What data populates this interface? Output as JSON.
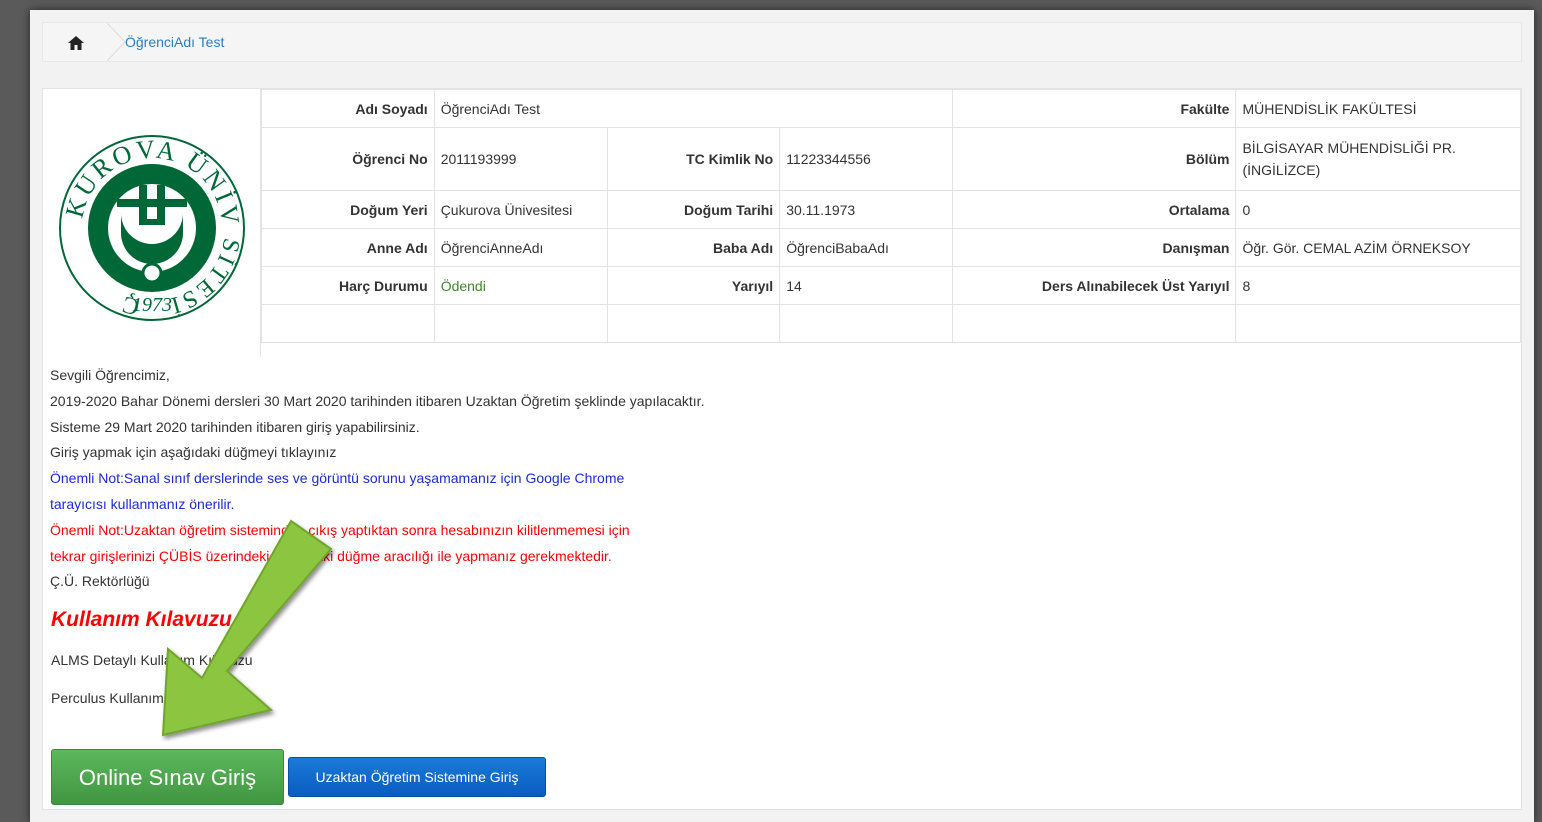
{
  "breadcrumb": {
    "home_icon": "home-icon",
    "current": "ÖğrenciAdı Test"
  },
  "logo": {
    "name": "Çukurova Üniversitesi logo",
    "text": "ÇUKUROVA ÜNİVERSİTESİ",
    "year": "1973",
    "color": "#006837"
  },
  "student": {
    "name_label": "Adı Soyadı",
    "name": "ÖğrenciAdı Test",
    "faculty_label": "Fakülte",
    "faculty": "MÜHENDİSLİK FAKÜLTESİ",
    "no_label": "Öğrenci No",
    "no": "2011193999",
    "tc_label": "TC Kimlik No",
    "tc": "11223344556",
    "dept_label": "Bölüm",
    "dept_line1": "BİLGİSAYAR MÜHENDİSLİĞİ PR.",
    "dept_line2": "(İNGİLİZCE)",
    "birthplace_label": "Doğum Yeri",
    "birthplace": "Çukurova Ünivesitesi",
    "birthdate_label": "Doğum Tarihi",
    "birthdate": "30.11.1973",
    "gpa_label": "Ortalama",
    "gpa": "0",
    "mother_label": "Anne Adı",
    "mother": "ÖğrenciAnneAdı",
    "father_label": "Baba Adı",
    "father": "ÖğrenciBabaAdı",
    "advisor_label": "Danışman",
    "advisor": "Öğr. Gör. CEMAL AZİM ÖRNEKSOY",
    "fee_label": "Harç Durumu",
    "fee": "Ödendi",
    "fee_color": "#3a8a2a",
    "term_label": "Yarıyıl",
    "term": "14",
    "max_term_label": "Ders Alınabilecek Üst Yarıyıl",
    "max_term": "8"
  },
  "notice": {
    "line1": "Sevgili Öğrencimiz,",
    "line2": "2019-2020 Bahar Dönemi dersleri 30 Mart 2020 tarihinden itibaren Uzaktan Öğretim şeklinde yapılacaktır.",
    "line3": "Sisteme 29 Mart 2020 tarihinden itibaren giriş yapabilirsiniz.",
    "line4": "Giriş yapmak için aşağıdaki düğmeyi tıklayınız",
    "blue1": "Önemli Not:Sanal sınıf derslerinde ses ve görüntü sorunu yaşamamanız için Google Chrome",
    "blue2": "tarayıcısı kullanmanız önerilir.",
    "red1": "Önemli Not:Uzaktan öğretim sisteminden çıkış yaptıktan sonra hesabınızın kilitlenmemesi için",
    "red2": "tekrar girişlerinizi ÇÜBİS üzerindeki aşağıdaki düğme aracılığı ile yapmanız gerekmektedir.",
    "signature": "Ç.Ü. Rektörlüğü"
  },
  "guide": {
    "title": "Kullanım Kılavuzu",
    "alms": "ALMS Detaylı Kullanım Kılavuzu",
    "perculus": "Perculus Kullanım Kılavuzu"
  },
  "buttons": {
    "online_exam": "Online Sınav Giriş",
    "remote": "Uzaktan Öğretim Sistemine Giriş"
  },
  "arrow": {
    "color": "#8cc63f"
  }
}
